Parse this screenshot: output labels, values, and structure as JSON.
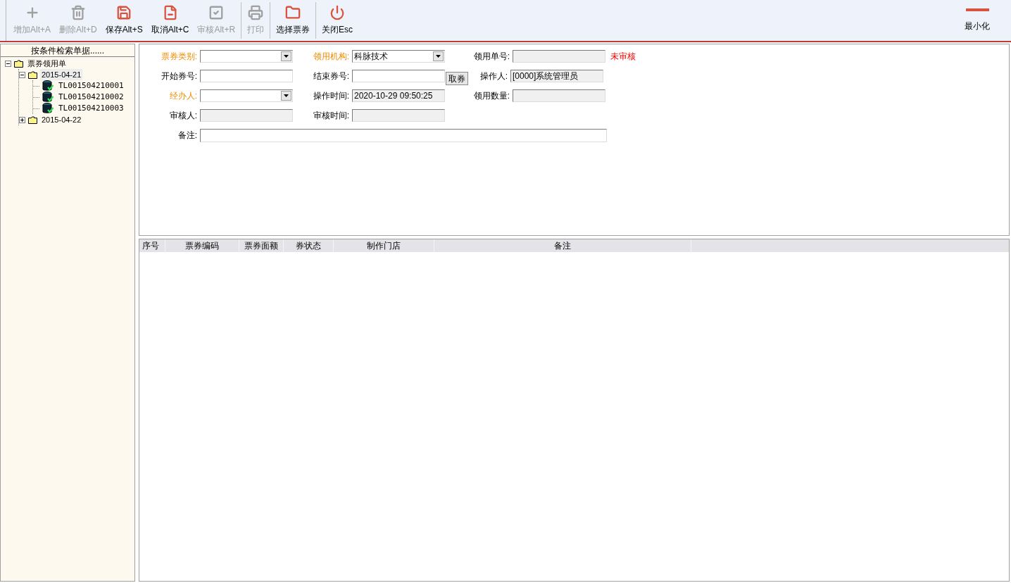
{
  "toolbar": {
    "buttons": [
      {
        "kind": "add",
        "label": "增加Alt+A",
        "disabled": true
      },
      {
        "kind": "delete",
        "label": "删除Alt+D",
        "disabled": true
      },
      {
        "kind": "save",
        "label": "保存Alt+S",
        "disabled": false
      },
      {
        "kind": "cancel",
        "label": "取消Alt+C",
        "disabled": false
      },
      {
        "kind": "approve",
        "label": "审核Alt+R",
        "disabled": true
      },
      {
        "kind": "print",
        "label": "打印",
        "disabled": true
      },
      {
        "kind": "folder",
        "label": "选择票券",
        "disabled": false
      },
      {
        "kind": "power",
        "label": "关闭Esc",
        "disabled": false
      }
    ],
    "minimize": {
      "label": "最小化"
    }
  },
  "sidebar": {
    "title": "按条件检索单据......",
    "tree": [
      {
        "label": "票券领用单",
        "kind": "folder",
        "expanded": true,
        "children": [
          {
            "label": "2015-04-21",
            "kind": "folder",
            "expanded": true,
            "selected": true,
            "children": [
              {
                "label": "TL001504210001",
                "kind": "doc",
                "selected": false
              },
              {
                "label": "TL001504210002",
                "kind": "doc",
                "selected": false
              },
              {
                "label": "TL001504210003",
                "kind": "doc",
                "selected": false
              }
            ]
          },
          {
            "label": "2015-04-22",
            "kind": "folder",
            "expanded": false,
            "selected": false
          }
        ]
      }
    ]
  },
  "form": {
    "rows": [
      [
        {
          "label": "票券类别:",
          "required": true,
          "kind": "select",
          "readonly": false
        },
        {
          "label": "领用机构:",
          "required": true,
          "kind": "select",
          "readonly": false,
          "value": "科脉技术"
        },
        {
          "label": "领用单号:",
          "required": false,
          "kind": "input",
          "readonly": true,
          "status": "未审核"
        }
      ],
      [
        {
          "label": "开始券号:",
          "required": false,
          "kind": "input",
          "readonly": false
        },
        {
          "label": "结束券号:",
          "required": false,
          "kind": "input",
          "readonly": false,
          "button": "取券"
        },
        {
          "label": "操作人:",
          "required": false,
          "kind": "input",
          "readonly": true,
          "value": "[0000]系统管理员"
        }
      ],
      [
        {
          "label": "经办人:",
          "required": true,
          "kind": "select",
          "readonly": false
        },
        {
          "label": "操作时间:",
          "required": false,
          "kind": "input",
          "readonly": true,
          "value": "2020-10-29 09:50:25"
        },
        {
          "label": "领用数量:",
          "required": false,
          "kind": "input",
          "readonly": true
        }
      ],
      [
        {
          "label": "审核人:",
          "required": false,
          "kind": "input",
          "readonly": true
        },
        {
          "label": "审核时间:",
          "required": false,
          "kind": "input",
          "readonly": true
        }
      ]
    ],
    "remark": {
      "label": "备注:"
    }
  },
  "table": {
    "columns": [
      "序号",
      "票券编码",
      "票券面额",
      "券状态",
      "制作门店",
      "备注"
    ]
  }
}
